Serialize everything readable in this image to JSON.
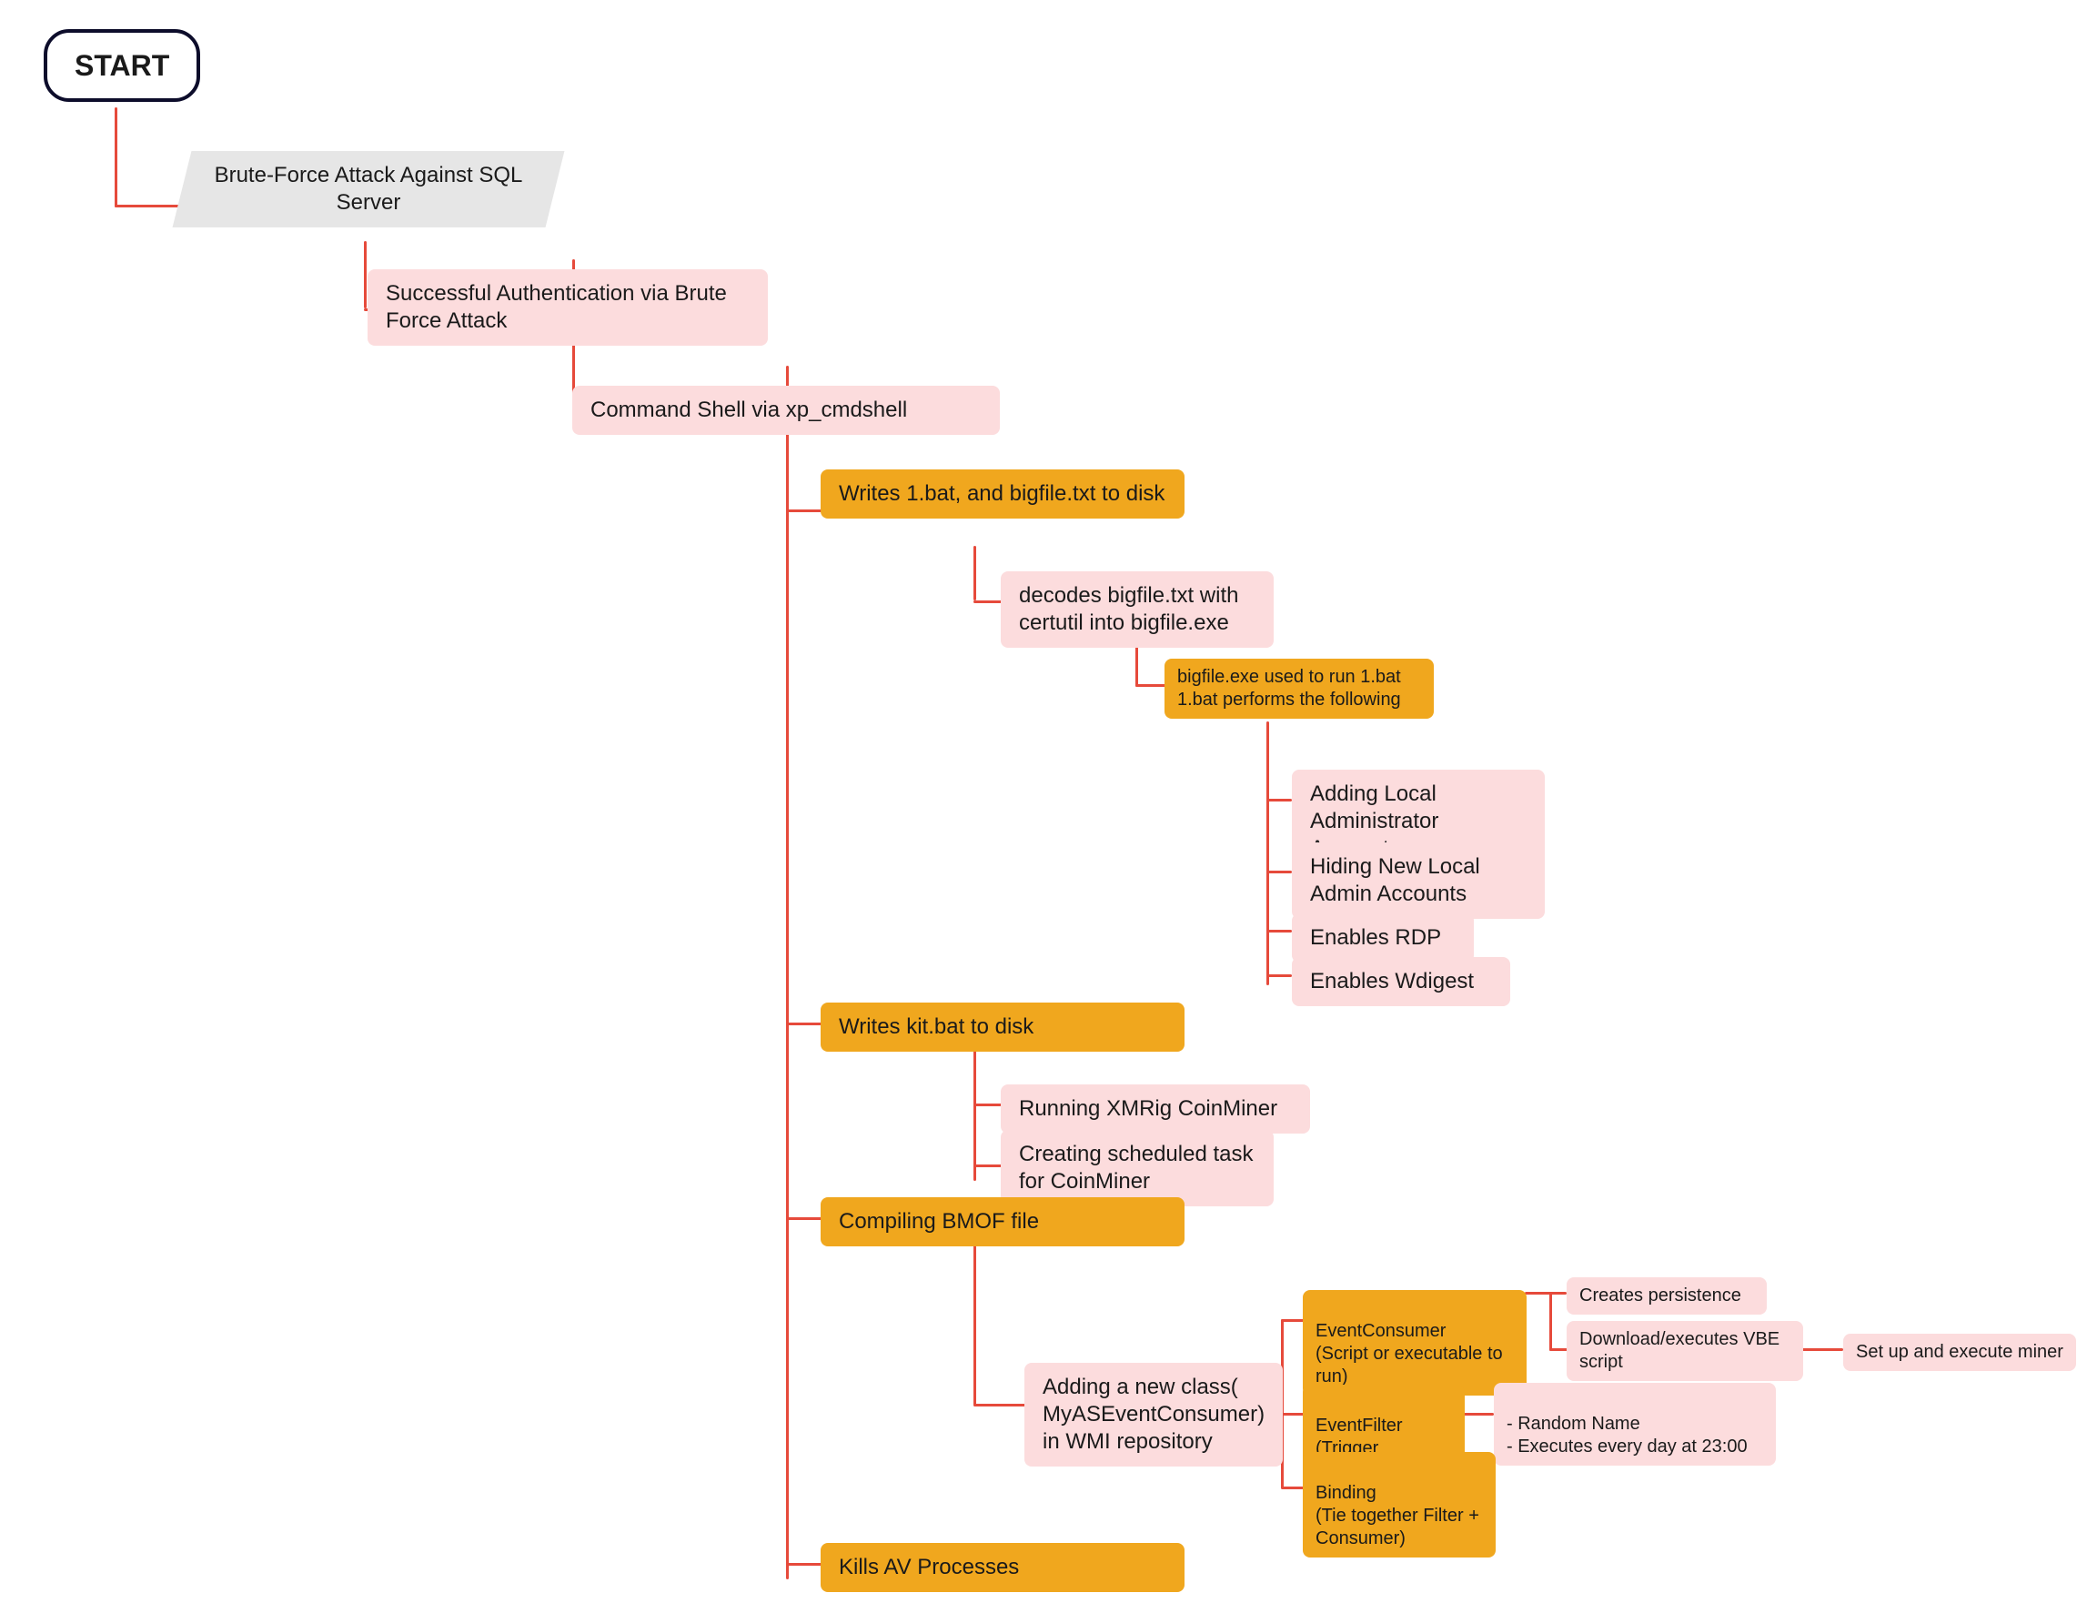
{
  "n": {
    "start": "START",
    "brute": "Brute-Force Attack Against SQL Server",
    "auth": "Successful Authentication via Brute Force Attack",
    "cmdshell": "Command Shell via xp_cmdshell",
    "writes1": "Writes 1.bat, and bigfile.txt to disk",
    "decode": "decodes bigfile.txt with certutil into bigfile.exe",
    "bigfile_run": "bigfile.exe used to run 1.bat 1.bat performs the following",
    "add_admin": "Adding Local Administrator Accounts",
    "hide_admin": "Hiding New Local Admin Accounts",
    "rdp": "Enables RDP",
    "wdigest": "Enables Wdigest",
    "writes_kit": "Writes kit.bat to disk",
    "xmrig": "Running XMRig CoinMiner",
    "schtask": "Creating scheduled task for CoinMiner",
    "bmof": "Compiling BMOF file",
    "wmi_class": "Adding a new class( MyASEventConsumer) in WMI repository",
    "evt_consumer": "EventConsumer\n(Script or executable to run)",
    "persistence": "Creates persistence",
    "vbe": "Download/executes VBE script",
    "miner": "Set up and execute miner",
    "evt_filter": "EventFilter\n(Trigger condition)",
    "filter_detail": "- Random Name\n- Executes every day at 23:00",
    "binding": "Binding\n(Tie together Filter + Consumer)",
    "kill_av": "Kills AV Processes"
  },
  "colors": {
    "connector": "#e64a3b",
    "pink": "#fcdcdd",
    "orange": "#f0a71e",
    "grey": "#e6e6e6"
  }
}
